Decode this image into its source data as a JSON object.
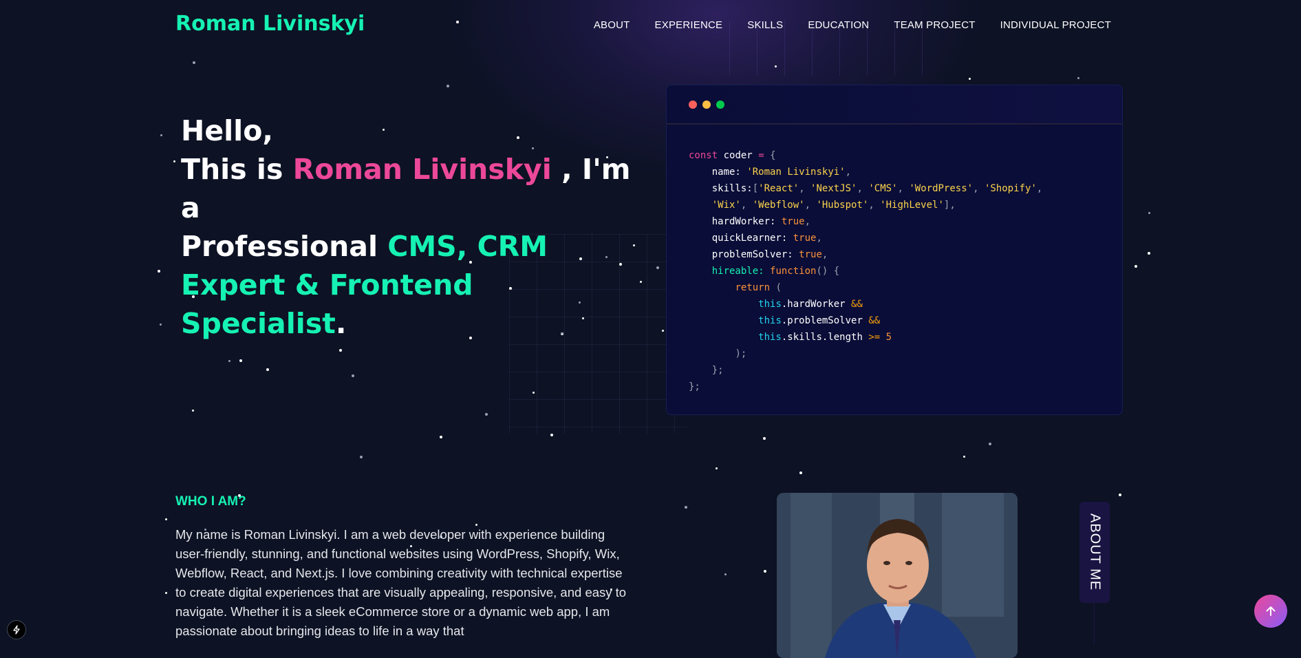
{
  "header": {
    "logo": "Roman Livinskyi",
    "nav": [
      "ABOUT",
      "EXPERIENCE",
      "SKILLS",
      "EDUCATION",
      "TEAM PROJECT",
      "INDIVIDUAL PROJECT"
    ]
  },
  "hero": {
    "line1": "Hello,",
    "this_is": "This is ",
    "name": "Roman Livinskyi",
    "im_a": " , I'm a",
    "professional": "Professional ",
    "roles": "CMS, CRM Expert & Frontend Specialist",
    "period": "."
  },
  "code_card": {
    "dot_colors": [
      "#ff605c",
      "#ffbd44",
      "#00ca4e"
    ],
    "line_const": "const",
    "line_coder": "coder",
    "line_eq": "=",
    "line_open": "{",
    "name_key": "name:",
    "name_val": "'Roman Livinskyi'",
    "skills_key": "skills:",
    "skills": [
      "'React'",
      "'NextJS'",
      "'CMS'",
      "'WordPress'",
      "'Shopify'",
      "'Wix'",
      "'Webflow'",
      "'Hubspot'",
      "'HighLevel'"
    ],
    "hardWorker_key": "hardWorker:",
    "quickLearner_key": "quickLearner:",
    "problemSolver_key": "problemSolver:",
    "true_val": "true",
    "hireable_key": "hireable:",
    "function_kw": "function",
    "return_kw": "return",
    "this_kw": "this",
    "hardWorker_prop": ".hardWorker",
    "problemSolver_prop": ".problemSolver",
    "skills_length": ".skills.length",
    "and_op": "&&",
    "gte_op": ">=",
    "five": "5"
  },
  "about": {
    "title": "WHO I AM?",
    "text": "My name is Roman Livinskyi. I am a web developer with experience building user-friendly, stunning, and functional websites using WordPress, Shopify, Wix, Webflow, React, and Next.js. I love combining creativity with technical expertise to create digital experiences that are visually appealing, responsive, and easy to navigate. Whether it is a sleek eCommerce store or a dynamic web app, I am passionate about bringing ideas to life in a way that",
    "tab_label": "ABOUT ME"
  },
  "icons": {
    "scroll_top": "arrow-up-icon",
    "corner": "lightning-icon"
  },
  "colors": {
    "background": "#0d1224",
    "accent_teal": "#16f2b3",
    "accent_pink": "#ec4899",
    "accent_purple": "#8b5cf6"
  }
}
